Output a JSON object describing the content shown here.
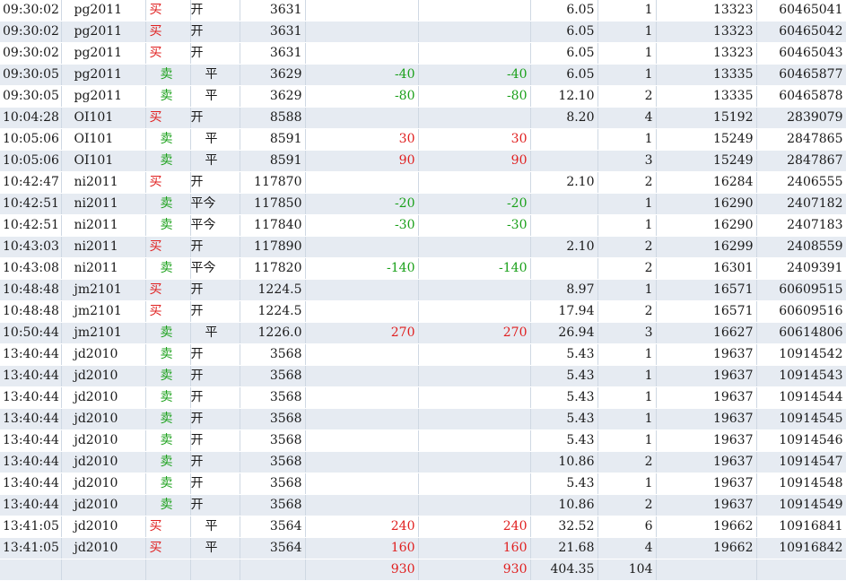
{
  "colors": {
    "buy": "#e02020",
    "sell": "#1aa01a",
    "row_alt": "#e6ebf2"
  },
  "rows": [
    {
      "time": "09:30:02",
      "contract": "pg2011",
      "dir": "买",
      "dir_type": "buy",
      "offset": "开",
      "price": "3631",
      "pl1": "",
      "pl2": "",
      "fee": "6.05",
      "qty": "1",
      "oid": "13323",
      "tid": "60465041"
    },
    {
      "time": "09:30:02",
      "contract": "pg2011",
      "dir": "买",
      "dir_type": "buy",
      "offset": "开",
      "price": "3631",
      "pl1": "",
      "pl2": "",
      "fee": "6.05",
      "qty": "1",
      "oid": "13323",
      "tid": "60465042"
    },
    {
      "time": "09:30:02",
      "contract": "pg2011",
      "dir": "买",
      "dir_type": "buy",
      "offset": "开",
      "price": "3631",
      "pl1": "",
      "pl2": "",
      "fee": "6.05",
      "qty": "1",
      "oid": "13323",
      "tid": "60465043"
    },
    {
      "time": "09:30:05",
      "contract": "pg2011",
      "dir": "卖",
      "dir_type": "sell",
      "offset": "平",
      "price": "3629",
      "pl1": "-40",
      "pl2": "-40",
      "fee": "6.05",
      "qty": "1",
      "oid": "13335",
      "tid": "60465877"
    },
    {
      "time": "09:30:05",
      "contract": "pg2011",
      "dir": "卖",
      "dir_type": "sell",
      "offset": "平",
      "price": "3629",
      "pl1": "-80",
      "pl2": "-80",
      "fee": "12.10",
      "qty": "2",
      "oid": "13335",
      "tid": "60465878"
    },
    {
      "time": "10:04:28",
      "contract": "OI101",
      "dir": "买",
      "dir_type": "buy",
      "offset": "开",
      "price": "8588",
      "pl1": "",
      "pl2": "",
      "fee": "8.20",
      "qty": "4",
      "oid": "15192",
      "tid": "2839079"
    },
    {
      "time": "10:05:06",
      "contract": "OI101",
      "dir": "卖",
      "dir_type": "sell",
      "offset": "平",
      "price": "8591",
      "pl1": "30",
      "pl2": "30",
      "fee": "",
      "qty": "1",
      "oid": "15249",
      "tid": "2847865"
    },
    {
      "time": "10:05:06",
      "contract": "OI101",
      "dir": "卖",
      "dir_type": "sell",
      "offset": "平",
      "price": "8591",
      "pl1": "90",
      "pl2": "90",
      "fee": "",
      "qty": "3",
      "oid": "15249",
      "tid": "2847867"
    },
    {
      "time": "10:42:47",
      "contract": "ni2011",
      "dir": "买",
      "dir_type": "buy",
      "offset": "开",
      "price": "117870",
      "pl1": "",
      "pl2": "",
      "fee": "2.10",
      "qty": "2",
      "oid": "16284",
      "tid": "2406555"
    },
    {
      "time": "10:42:51",
      "contract": "ni2011",
      "dir": "卖",
      "dir_type": "sell",
      "offset": "平今",
      "price": "117850",
      "pl1": "-20",
      "pl2": "-20",
      "fee": "",
      "qty": "1",
      "oid": "16290",
      "tid": "2407182"
    },
    {
      "time": "10:42:51",
      "contract": "ni2011",
      "dir": "卖",
      "dir_type": "sell",
      "offset": "平今",
      "price": "117840",
      "pl1": "-30",
      "pl2": "-30",
      "fee": "",
      "qty": "1",
      "oid": "16290",
      "tid": "2407183"
    },
    {
      "time": "10:43:03",
      "contract": "ni2011",
      "dir": "买",
      "dir_type": "buy",
      "offset": "开",
      "price": "117890",
      "pl1": "",
      "pl2": "",
      "fee": "2.10",
      "qty": "2",
      "oid": "16299",
      "tid": "2408559"
    },
    {
      "time": "10:43:08",
      "contract": "ni2011",
      "dir": "卖",
      "dir_type": "sell",
      "offset": "平今",
      "price": "117820",
      "pl1": "-140",
      "pl2": "-140",
      "fee": "",
      "qty": "2",
      "oid": "16301",
      "tid": "2409391"
    },
    {
      "time": "10:48:48",
      "contract": "jm2101",
      "dir": "买",
      "dir_type": "buy",
      "offset": "开",
      "price": "1224.5",
      "pl1": "",
      "pl2": "",
      "fee": "8.97",
      "qty": "1",
      "oid": "16571",
      "tid": "60609515"
    },
    {
      "time": "10:48:48",
      "contract": "jm2101",
      "dir": "买",
      "dir_type": "buy",
      "offset": "开",
      "price": "1224.5",
      "pl1": "",
      "pl2": "",
      "fee": "17.94",
      "qty": "2",
      "oid": "16571",
      "tid": "60609516"
    },
    {
      "time": "10:50:44",
      "contract": "jm2101",
      "dir": "卖",
      "dir_type": "sell",
      "offset": "平",
      "price": "1226.0",
      "pl1": "270",
      "pl2": "270",
      "fee": "26.94",
      "qty": "3",
      "oid": "16627",
      "tid": "60614806"
    },
    {
      "time": "13:40:44",
      "contract": "jd2010",
      "dir": "卖",
      "dir_type": "sell",
      "offset": "开",
      "price": "3568",
      "pl1": "",
      "pl2": "",
      "fee": "5.43",
      "qty": "1",
      "oid": "19637",
      "tid": "10914542"
    },
    {
      "time": "13:40:44",
      "contract": "jd2010",
      "dir": "卖",
      "dir_type": "sell",
      "offset": "开",
      "price": "3568",
      "pl1": "",
      "pl2": "",
      "fee": "5.43",
      "qty": "1",
      "oid": "19637",
      "tid": "10914543"
    },
    {
      "time": "13:40:44",
      "contract": "jd2010",
      "dir": "卖",
      "dir_type": "sell",
      "offset": "开",
      "price": "3568",
      "pl1": "",
      "pl2": "",
      "fee": "5.43",
      "qty": "1",
      "oid": "19637",
      "tid": "10914544"
    },
    {
      "time": "13:40:44",
      "contract": "jd2010",
      "dir": "卖",
      "dir_type": "sell",
      "offset": "开",
      "price": "3568",
      "pl1": "",
      "pl2": "",
      "fee": "5.43",
      "qty": "1",
      "oid": "19637",
      "tid": "10914545"
    },
    {
      "time": "13:40:44",
      "contract": "jd2010",
      "dir": "卖",
      "dir_type": "sell",
      "offset": "开",
      "price": "3568",
      "pl1": "",
      "pl2": "",
      "fee": "5.43",
      "qty": "1",
      "oid": "19637",
      "tid": "10914546"
    },
    {
      "time": "13:40:44",
      "contract": "jd2010",
      "dir": "卖",
      "dir_type": "sell",
      "offset": "开",
      "price": "3568",
      "pl1": "",
      "pl2": "",
      "fee": "10.86",
      "qty": "2",
      "oid": "19637",
      "tid": "10914547"
    },
    {
      "time": "13:40:44",
      "contract": "jd2010",
      "dir": "卖",
      "dir_type": "sell",
      "offset": "开",
      "price": "3568",
      "pl1": "",
      "pl2": "",
      "fee": "5.43",
      "qty": "1",
      "oid": "19637",
      "tid": "10914548"
    },
    {
      "time": "13:40:44",
      "contract": "jd2010",
      "dir": "卖",
      "dir_type": "sell",
      "offset": "开",
      "price": "3568",
      "pl1": "",
      "pl2": "",
      "fee": "10.86",
      "qty": "2",
      "oid": "19637",
      "tid": "10914549"
    },
    {
      "time": "13:41:05",
      "contract": "jd2010",
      "dir": "买",
      "dir_type": "buy",
      "offset": "平",
      "price": "3564",
      "pl1": "240",
      "pl2": "240",
      "fee": "32.52",
      "qty": "6",
      "oid": "19662",
      "tid": "10916841"
    },
    {
      "time": "13:41:05",
      "contract": "jd2010",
      "dir": "买",
      "dir_type": "buy",
      "offset": "平",
      "price": "3564",
      "pl1": "160",
      "pl2": "160",
      "fee": "21.68",
      "qty": "4",
      "oid": "19662",
      "tid": "10916842"
    }
  ],
  "totals": {
    "pl1": "930",
    "pl2": "930",
    "fee": "404.35",
    "qty": "104"
  }
}
